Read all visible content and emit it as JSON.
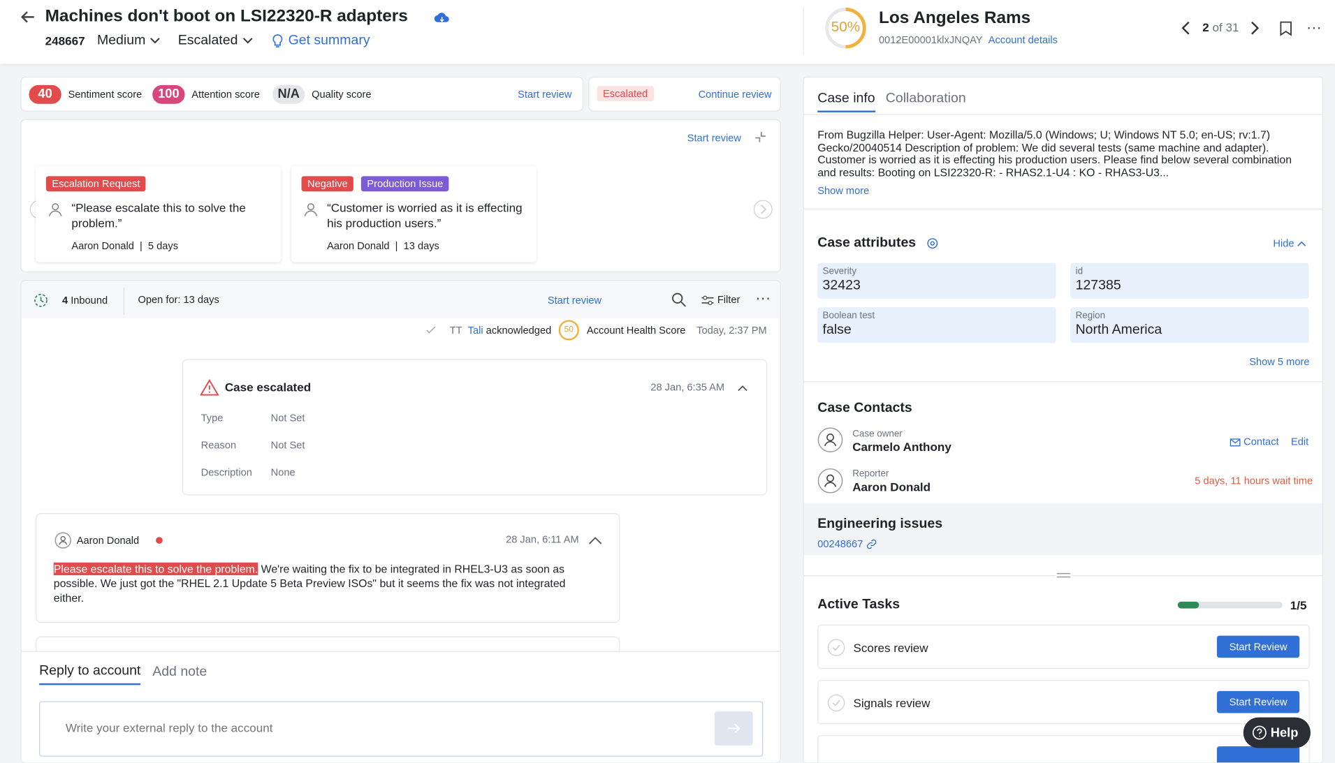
{
  "header": {
    "title": "Machines don't boot on LSI22320-R adapters",
    "case_number": "248667",
    "priority": "Medium",
    "status": "Escalated",
    "get_summary": "Get summary",
    "health_percent": "50%",
    "account_name": "Los Angeles Rams",
    "account_id": "0012E00001klxJNQAY",
    "account_details": "Account details",
    "pager_current": "2",
    "pager_text": "of 31"
  },
  "scores": {
    "sentiment_value": "40",
    "sentiment_label": "Sentiment score",
    "attention_value": "100",
    "attention_label": "Attention score",
    "quality_value": "N/A",
    "quality_label": "Quality score",
    "start_review": "Start review",
    "escalated_badge": "Escalated",
    "continue_review": "Continue review"
  },
  "signals": {
    "start_review": "Start review",
    "cards": [
      {
        "tags": [
          "Escalation Request"
        ],
        "quote": "“Please escalate this to solve the problem.”",
        "author": "Aaron Donald",
        "age": "5 days"
      },
      {
        "tags": [
          "Negative",
          "Production Issue"
        ],
        "quote": "“Customer is worried as it is effecting his production users.”",
        "author": "Aaron Donald",
        "age": "13 days"
      }
    ]
  },
  "timeline": {
    "inbound_count": "4",
    "inbound_label": "Inbound",
    "open_for": "Open for: 13 days",
    "start_review": "Start review",
    "filter": "Filter",
    "ack_initials": "TT",
    "ack_user": "Tali",
    "ack_text": "acknowledged",
    "ack_score": "50",
    "ack_item": "Account Health Score",
    "ack_time": "Today, 2:37 PM",
    "escalation": {
      "title": "Case escalated",
      "time": "28 Jan, 6:35 AM",
      "rows": [
        {
          "k": "Type",
          "v": "Not Set"
        },
        {
          "k": "Reason",
          "v": "Not Set"
        },
        {
          "k": "Description",
          "v": "None"
        }
      ]
    },
    "message": {
      "author": "Aaron Donald",
      "time": "28 Jan, 6:11 AM",
      "highlight": "Please escalate this to solve the problem.",
      "body": " We're waiting the fix to be integrated in RHEL3-U3 as soon as possible. We just got the \"RHEL 2.1 Update 5 Beta Preview ISOs\" but it seems the fix was not integrated either."
    }
  },
  "reply": {
    "tab_reply": "Reply to account",
    "tab_note": "Add note",
    "placeholder": "Write your external reply to the account"
  },
  "right": {
    "tab_case_info": "Case info",
    "tab_collab": "Collaboration",
    "description": "From Bugzilla Helper: User-Agent: Mozilla/5.0 (Windows; U; Windows NT 5.0; en-US; rv:1.7) Gecko/20040514 Description of problem: We did several tests (same machine and adapter). Customer is worried as it is effecting his production users. Please find below several combination and results: Booting on LSI22320-R: - RHAS2.1-U4 : KO - RHAS3-U3...",
    "show_more": "Show more",
    "attributes_title": "Case attributes",
    "hide": "Hide",
    "attributes": [
      {
        "k": "Severity",
        "v": "32423"
      },
      {
        "k": "id",
        "v": "127385"
      },
      {
        "k": "Boolean test",
        "v": "false"
      },
      {
        "k": "Region",
        "v": "North America"
      }
    ],
    "show_5_more": "Show 5 more",
    "contacts_title": "Case Contacts",
    "owner_label": "Case owner",
    "owner_name": "Carmelo Anthony",
    "contact": "Contact",
    "edit": "Edit",
    "reporter_label": "Reporter",
    "reporter_name": "Aaron Donald",
    "wait_time": "5 days, 11 hours wait time",
    "eng_title": "Engineering issues",
    "eng_link": "00248667",
    "tasks_title": "Active Tasks",
    "tasks_count": "1/5",
    "tasks_progress": 0.2,
    "tasks": [
      {
        "label": "Scores review",
        "button": "Start Review"
      },
      {
        "label": "Signals review",
        "button": "Start Review"
      }
    ],
    "help": "Help"
  },
  "colors": {
    "accent": "#2f6fd6",
    "danger": "#e14b4b",
    "pink": "#d9467b",
    "purple": "#7c5cd6",
    "progress": "#2e8b57"
  }
}
